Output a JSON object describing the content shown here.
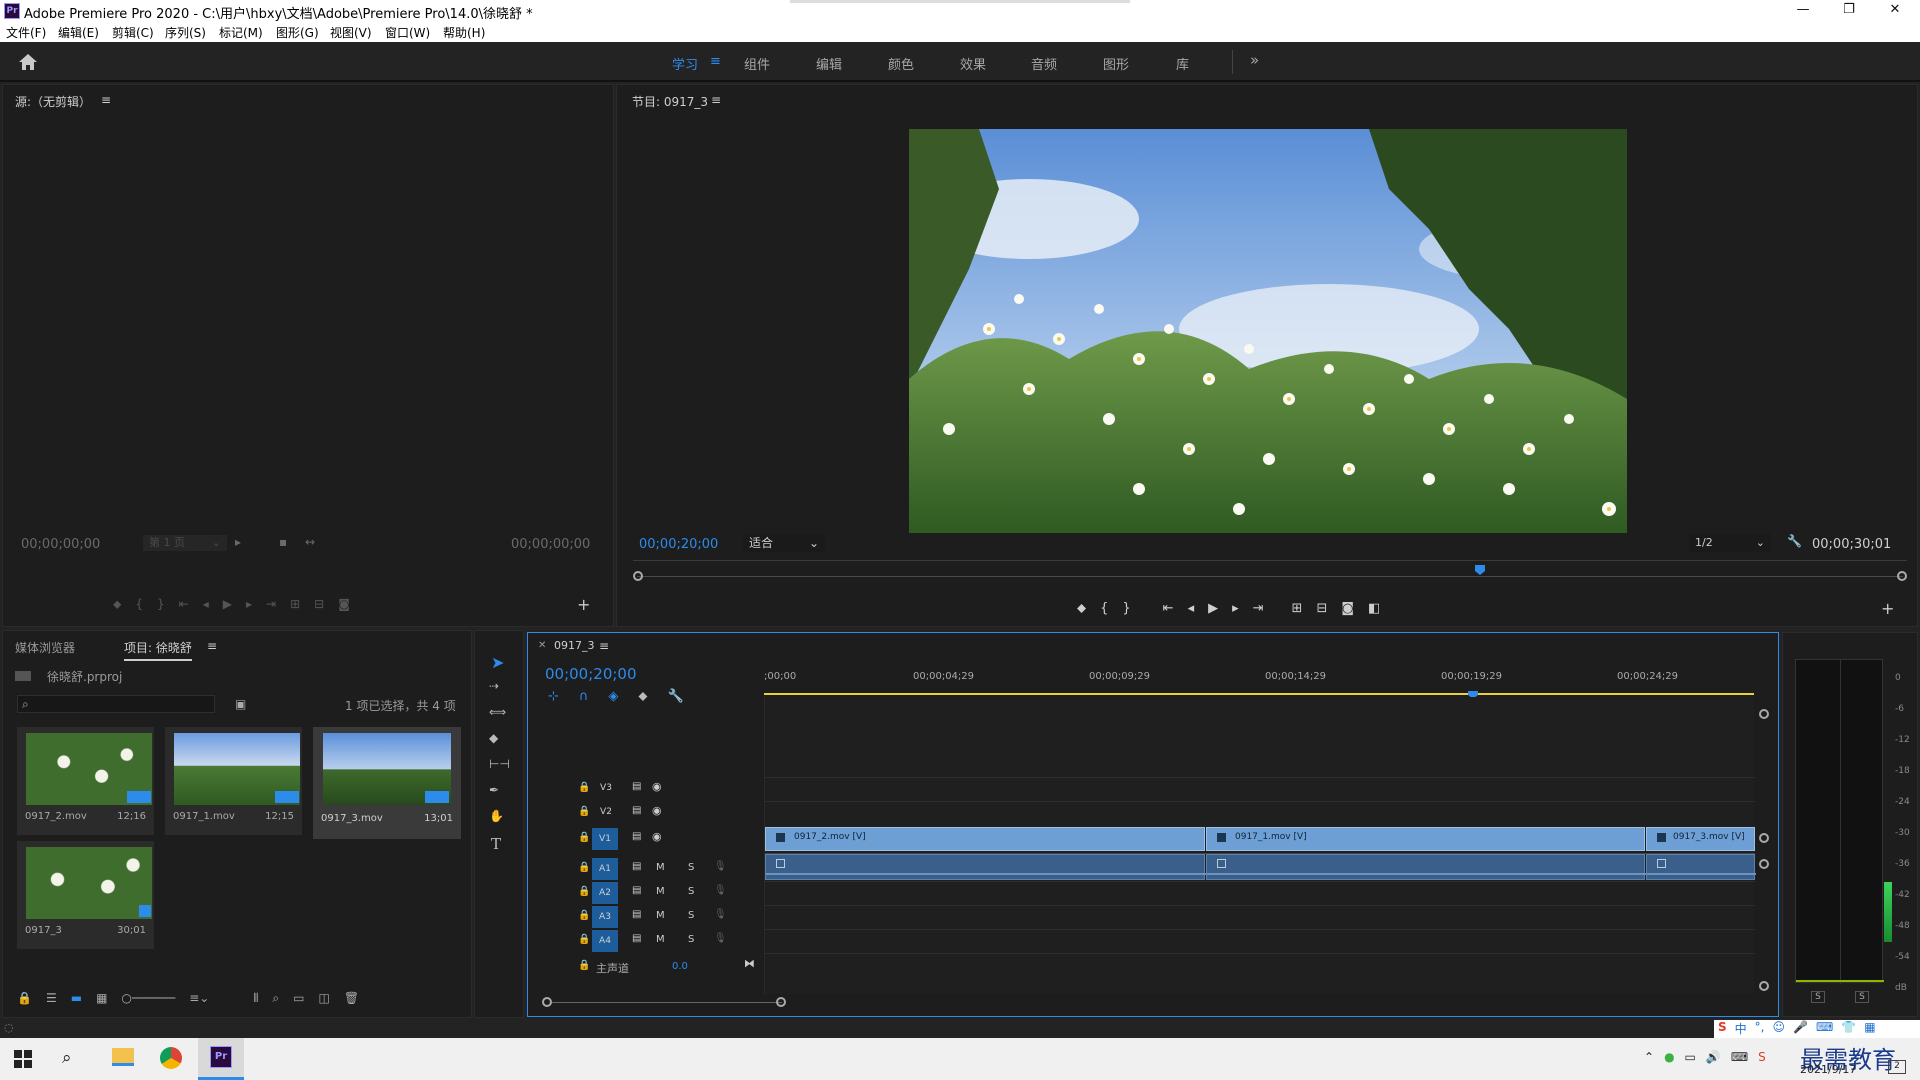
{
  "titlebar": {
    "app_title": "Adobe Premiere Pro 2020 - C:\\用户\\hbxy\\文档\\Adobe\\Premiere Pro\\14.0\\徐晓舒 *",
    "minimize": "—",
    "restore": "❐",
    "close": "✕"
  },
  "menu": [
    "文件(F)",
    "编辑(E)",
    "剪辑(C)",
    "序列(S)",
    "标记(M)",
    "图形(G)",
    "视图(V)",
    "窗口(W)",
    "帮助(H)"
  ],
  "workspaces": {
    "items": [
      "学习",
      "组件",
      "编辑",
      "颜色",
      "效果",
      "音频",
      "图形",
      "库"
    ],
    "more": "»",
    "active_menu": "≡"
  },
  "source": {
    "title": "源:（无剪辑）",
    "tc_left": "00;00;00;00",
    "page": "第 1 页",
    "tc_right": "00;00;00;00"
  },
  "program": {
    "title": "节目: 0917_3",
    "tc_current": "00;00;20;00",
    "fit": "适合",
    "resolution": "1/2",
    "tc_total": "00;00;30;01"
  },
  "project": {
    "tab_media": "媒体浏览器",
    "tab_project": "项目: 徐晓舒",
    "filename": "徐晓舒.prproj",
    "selection": "1 项已选择，共 4 项",
    "items": [
      {
        "name": "0917_2.mov",
        "duration": "12;16"
      },
      {
        "name": "0917_1.mov",
        "duration": "12;15"
      },
      {
        "name": "0917_3.mov",
        "duration": "13;01"
      },
      {
        "name": "0917_3",
        "duration": "30;01"
      }
    ]
  },
  "timeline": {
    "tab": "0917_3",
    "tc": "00;00;20;00",
    "ruler": [
      ";00;00",
      "00;00;04;29",
      "00;00;09;29",
      "00;00;14;29",
      "00;00;19;29",
      "00;00;24;29"
    ],
    "video_tracks": [
      "V3",
      "V2",
      "V1"
    ],
    "audio_tracks": [
      "A1",
      "A2",
      "A3",
      "A4"
    ],
    "master": "主声道",
    "master_value": "0.0",
    "mute": "M",
    "solo": "S",
    "clips": [
      "0917_2.mov [V]",
      "0917_1.mov [V]",
      "0917_3.mov [V]"
    ]
  },
  "meter": {
    "scale": [
      "0",
      "-6",
      "-12",
      "-18",
      "-24",
      "-30",
      "-36",
      "-42",
      "-48",
      "-54",
      "dB"
    ],
    "solo_left": "S",
    "solo_right": "S"
  },
  "taskbar": {
    "date": "2021/9/17",
    "watermark": "最需教育",
    "ime": "中"
  },
  "colors": {
    "accent": "#2d8ceb",
    "clip_video": "#6d9fd5",
    "clip_audio": "#3b5f8b"
  }
}
